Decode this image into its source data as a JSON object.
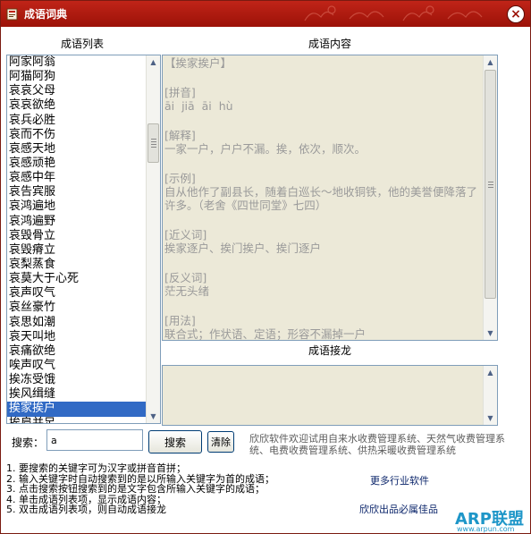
{
  "window": {
    "title": "成语词典",
    "close_glyph": "×"
  },
  "headers": {
    "list": "成语列表",
    "content": "成语内容",
    "chain": "成语接龙"
  },
  "idiom_list": {
    "items": [
      "阿家阿翁",
      "阿猫阿狗",
      "哀哀父母",
      "哀哀欲绝",
      "哀兵必胜",
      "哀而不伤",
      "哀感天地",
      "哀感顽艳",
      "哀感中年",
      "哀告宾服",
      "哀鸿遍地",
      "哀鸿遍野",
      "哀毁骨立",
      "哀毁瘠立",
      "哀梨蒸食",
      "哀莫大于心死",
      "哀声叹气",
      "哀丝豪竹",
      "哀思如潮",
      "哀天叫地",
      "哀痛欲绝",
      "唉声叹气",
      "挨冻受饿",
      "挨风缉缝",
      "挨家挨户",
      "挨肩并足"
    ],
    "selected_index": 24,
    "scroll_position": 0.18
  },
  "content": {
    "title": "【挨家挨户】",
    "sections": [
      {
        "heading": "[拼音]",
        "body": "āi  jiā  āi  hù"
      },
      {
        "heading": "[解释]",
        "body": "一家一户，户户不漏。挨，依次，顺次。"
      },
      {
        "heading": "[示例]",
        "body": "自从他作了副县长，随着白巡长～地收铜铁，他的美誉便降落了许多。（老舍《四世同堂》七四）"
      },
      {
        "heading": "[近义词]",
        "body": "挨家逐户、挨门挨户、挨门逐户"
      },
      {
        "heading": "[反义词]",
        "body": "茫无头绪"
      },
      {
        "heading": "[用法]",
        "body": "联合式；作状语、定语；形容不漏掉一户"
      }
    ]
  },
  "search": {
    "label": "搜索：",
    "value": "a",
    "search_button": "搜索",
    "clear_button": "清除"
  },
  "ad_text": "欣欣软件欢迎试用自来水收费管理系统、天然气收费管理系统、电费收费管理系统、供热采暖收费管理系统",
  "tips": [
    "1. 要搜索的关键字可为汉字或拼音首拼；",
    "2. 输入关键字时自动搜索到的是以所输入关键字为首的成语；",
    "3. 点击搜索按钮搜索到的是文字包含所输入关键字的成语；",
    "4. 单击成语列表项，显示成语内容；",
    "5. 双击成语列表项，则自动成语接龙"
  ],
  "more_link": "更多行业软件",
  "slogan": "欣欣出品必属佳品",
  "watermark": {
    "brand": "ARP联盟",
    "url": "www.arpun.com"
  },
  "icons": {
    "app": "app-icon",
    "close": "close-icon",
    "scroll_up": "scroll-up-arrow-icon",
    "scroll_down": "scroll-down-arrow-icon"
  },
  "colors": {
    "titlebar": "#b01c10",
    "selection": "#316ac5",
    "content_text": "#9a9a9a",
    "watermark": "#1e96c8"
  }
}
